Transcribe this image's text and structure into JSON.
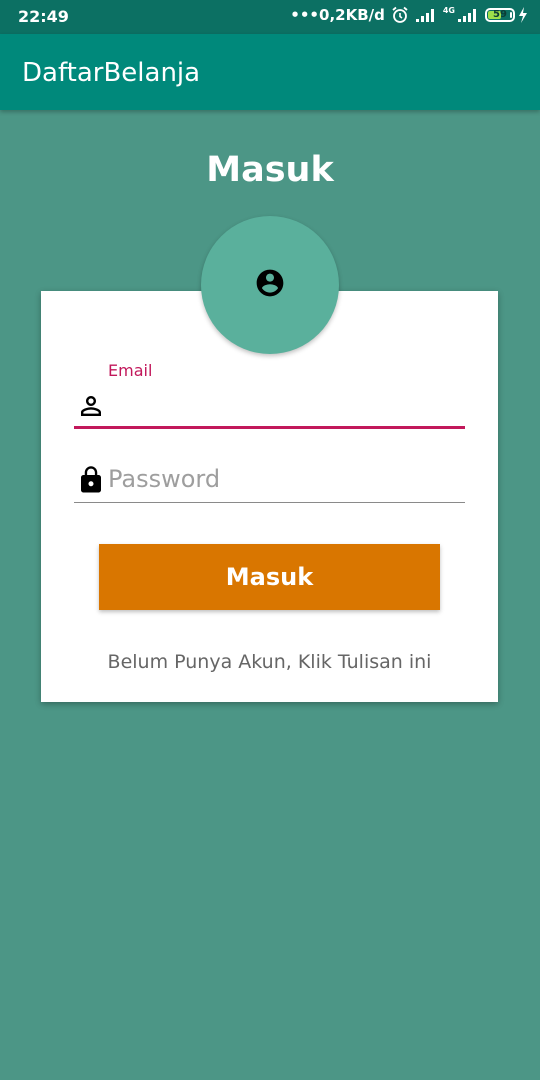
{
  "status_bar": {
    "time": "22:49",
    "net_speed": "•••0,2KB/d",
    "network_label": "4G",
    "battery_percent": "59",
    "battery_level": 59,
    "icons": [
      "alarm-icon",
      "signal-icon",
      "signal-4g-icon",
      "battery-icon",
      "charging-icon"
    ]
  },
  "app_bar": {
    "title": "DaftarBelanja"
  },
  "page": {
    "heading": "Masuk",
    "avatar_icon": "account-circle-icon"
  },
  "form": {
    "email_label": "Email",
    "email_value": "",
    "email_icon": "person-icon",
    "password_placeholder": "Password",
    "password_value": "",
    "password_icon": "lock-icon",
    "submit_label": "Masuk",
    "register_link": "Belum Punya Akun, Klik Tulisan ini"
  },
  "colors": {
    "status_bar": "#0c7063",
    "app_bar": "#00897b",
    "background": "#4c9686",
    "avatar": "#5ab09c",
    "accent": "#c2185b",
    "button": "#d97600"
  }
}
